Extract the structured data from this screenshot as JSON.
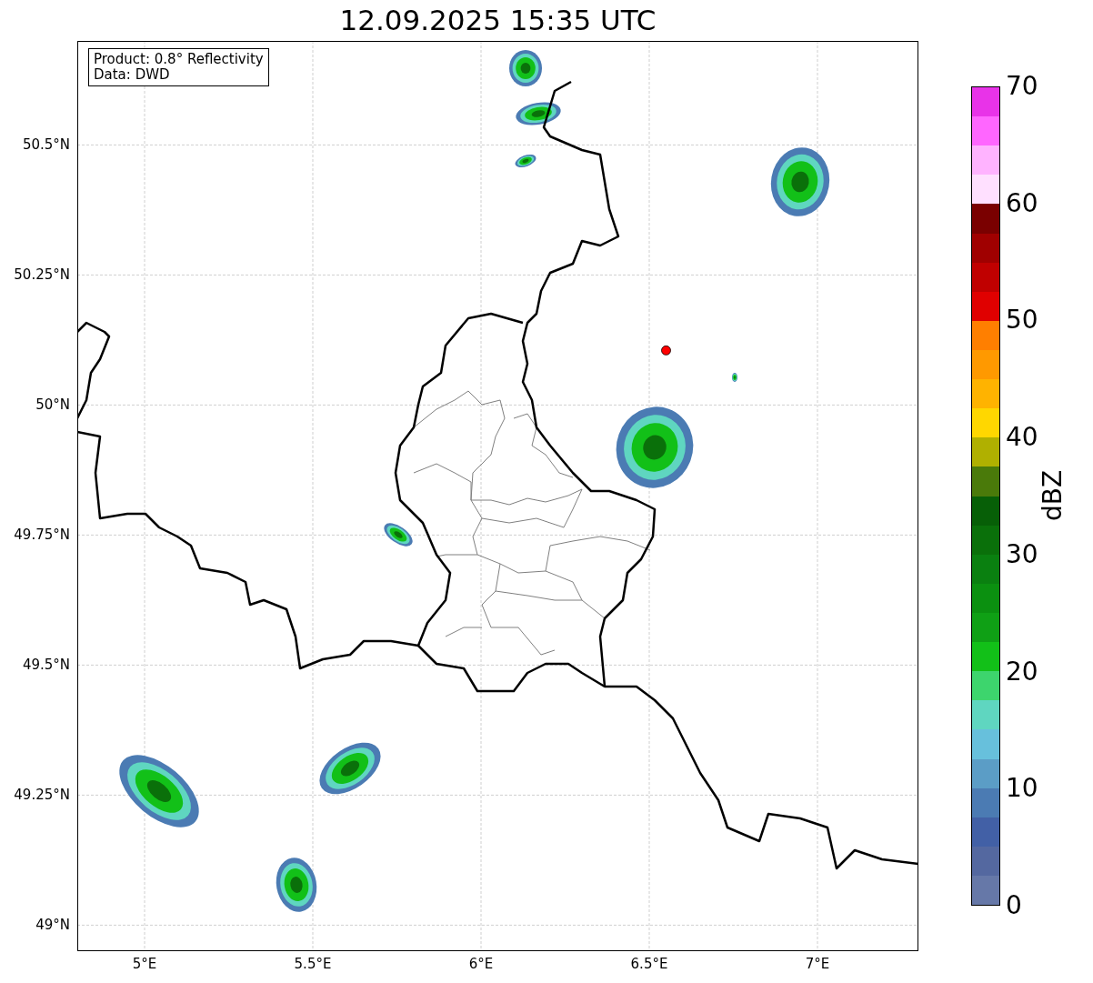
{
  "title": "12.09.2025 15:35 UTC",
  "info_box": {
    "lines": [
      "Product: 0.8° Reflectivity",
      "Data: DWD"
    ]
  },
  "map": {
    "lon_ticks": [
      "5°E",
      "5.5°E",
      "6°E",
      "6.5°E",
      "7°E"
    ],
    "lat_ticks": [
      "50.5°N",
      "50.25°N",
      "50°N",
      "49.75°N",
      "49.5°N",
      "49.25°N",
      "49°N"
    ]
  },
  "colorbar": {
    "label": "dBZ",
    "ticks": [
      "70",
      "60",
      "50",
      "40",
      "30",
      "20",
      "10",
      "0"
    ],
    "bands": [
      {
        "color": "#e833e8"
      },
      {
        "color": "#ff66ff"
      },
      {
        "color": "#ffb3ff"
      },
      {
        "color": "#ffe0ff"
      },
      {
        "color": "#7a0000"
      },
      {
        "color": "#a00000"
      },
      {
        "color": "#c00000"
      },
      {
        "color": "#e00000"
      },
      {
        "color": "#ff7f00"
      },
      {
        "color": "#ff9900"
      },
      {
        "color": "#ffb300"
      },
      {
        "color": "#ffd700"
      },
      {
        "color": "#b0b000"
      },
      {
        "color": "#4a7a0a"
      },
      {
        "color": "#075f07"
      },
      {
        "color": "#0a700a"
      },
      {
        "color": "#0a8010"
      },
      {
        "color": "#0b9010"
      },
      {
        "color": "#0fa015"
      },
      {
        "color": "#12c018"
      },
      {
        "color": "#3dd56d"
      },
      {
        "color": "#5fd6c0"
      },
      {
        "color": "#67c0dc"
      },
      {
        "color": "#5b9dc6"
      },
      {
        "color": "#4b7bb3"
      },
      {
        "color": "#4260a6"
      },
      {
        "color": "#5468a0"
      },
      {
        "color": "#6678a8"
      }
    ]
  }
}
